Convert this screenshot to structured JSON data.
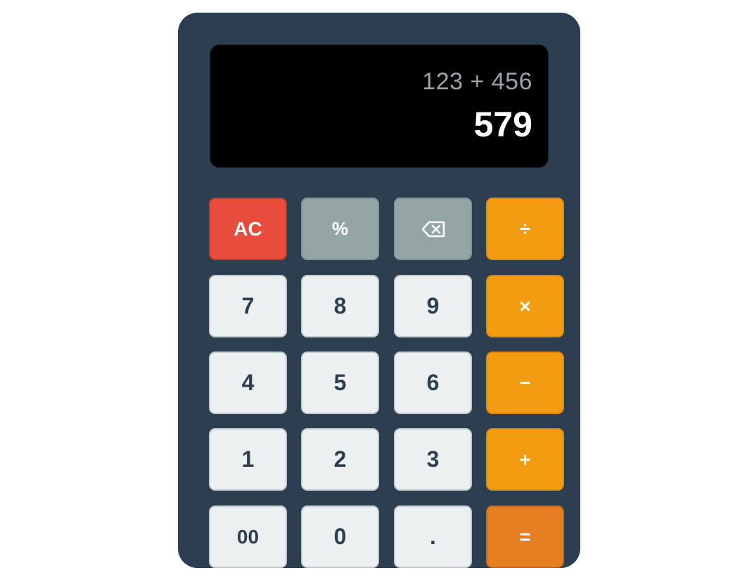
{
  "display": {
    "expression": "123 + 456",
    "result": "579"
  },
  "keys": {
    "clear": "AC",
    "percent": "%",
    "backspace_icon": "backspace-icon",
    "divide": "÷",
    "seven": "7",
    "eight": "8",
    "nine": "9",
    "multiply": "×",
    "four": "4",
    "five": "5",
    "six": "6",
    "subtract": "−",
    "one": "1",
    "two": "2",
    "three": "3",
    "add": "+",
    "double_zero": "00",
    "zero": "0",
    "decimal": ".",
    "equals": "="
  },
  "colors": {
    "body": "#2d3e50",
    "display_bg": "#000000",
    "number_key": "#ecf0f1",
    "operator_key": "#f39c12",
    "function_key": "#95a5a6",
    "clear_key": "#e74c3c",
    "equals_key": "#e67e22"
  }
}
